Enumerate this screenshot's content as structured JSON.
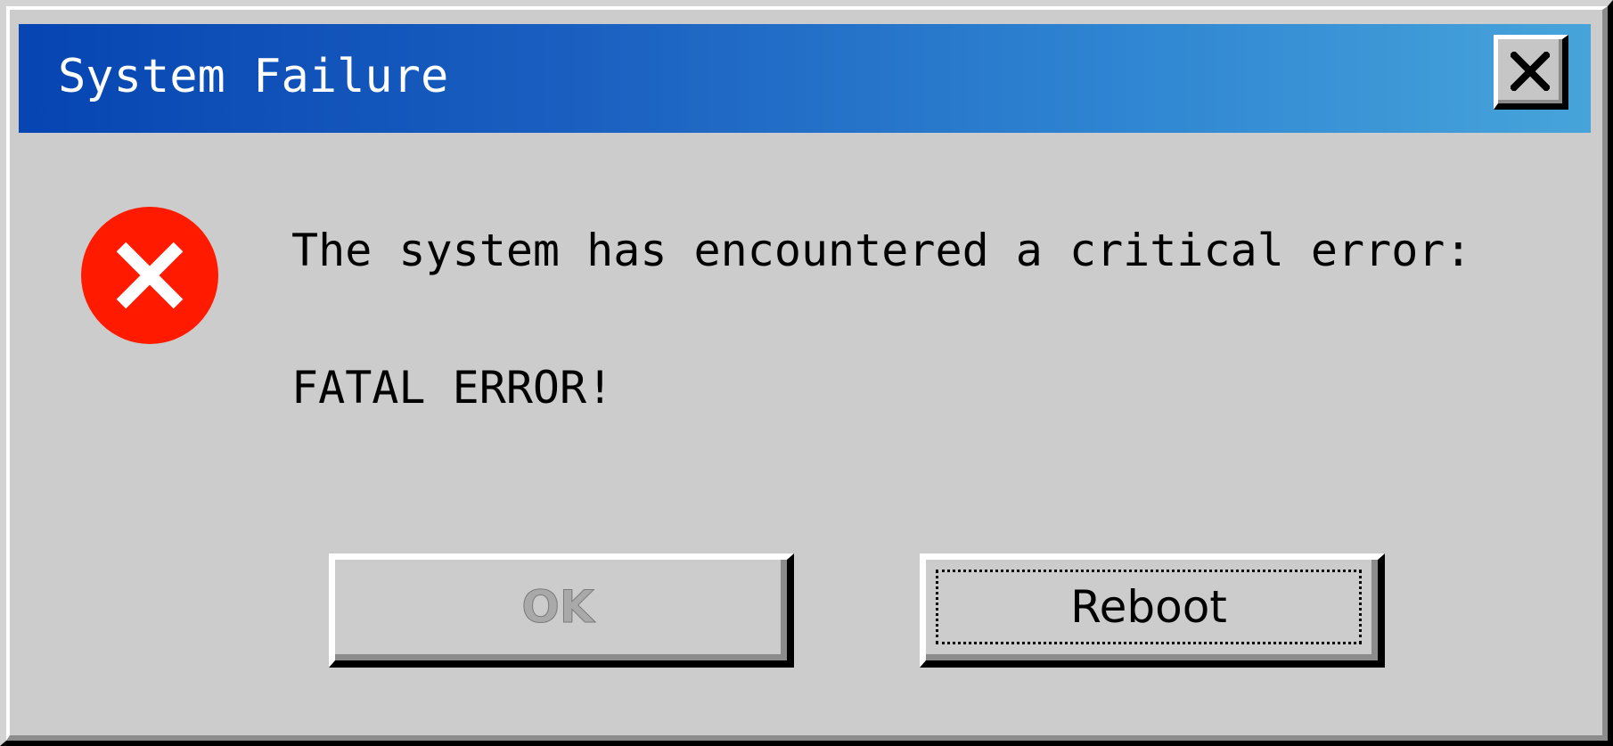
{
  "window": {
    "title": "System Failure"
  },
  "icons": {
    "error": "error-circle-x-icon",
    "close": "close-x-icon"
  },
  "colors": {
    "title_gradient_start": "#0645b2",
    "title_gradient_end": "#47a4da",
    "error_red": "#ff1a00",
    "dialog_background": "#cccccc",
    "disabled_text": "#a9a9a9"
  },
  "message": {
    "line1": "The system has encountered a critical error:",
    "line2": "FATAL ERROR!"
  },
  "buttons": {
    "ok_label": "OK",
    "reboot_label": "Reboot"
  }
}
